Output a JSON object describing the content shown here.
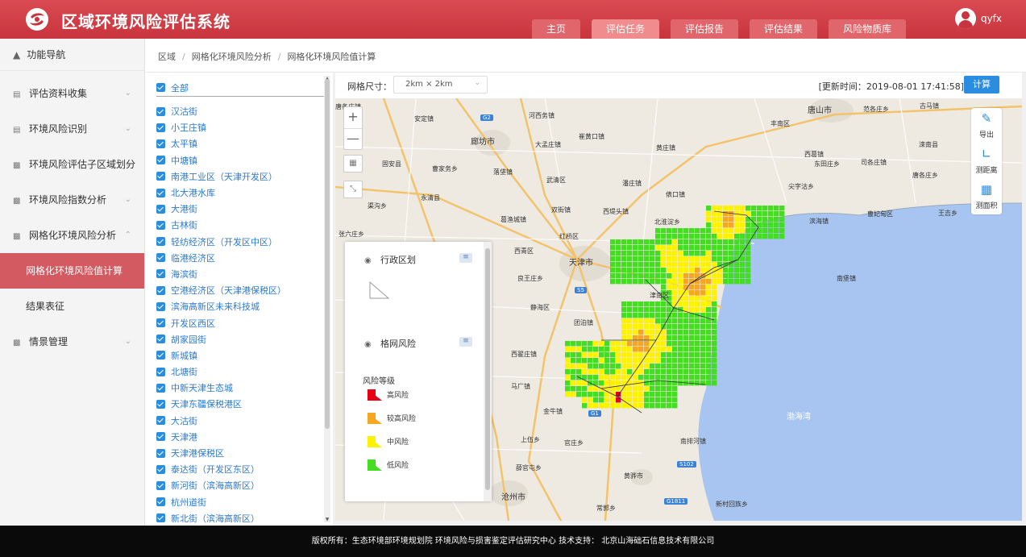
{
  "app": {
    "title": "区域环境风险评估系统"
  },
  "header": {
    "tabs": [
      {
        "label": "主页",
        "active": false
      },
      {
        "label": "评估任务",
        "active": true
      },
      {
        "label": "评估报告",
        "active": false
      },
      {
        "label": "评估结果",
        "active": false
      },
      {
        "label": "风险物质库",
        "active": false
      }
    ],
    "user": "qyfx"
  },
  "sidebar": {
    "heading": "功能导航",
    "items": [
      {
        "label": "评估资料收集"
      },
      {
        "label": "环境风险识别"
      },
      {
        "label": "环境风险评估子区域划分"
      },
      {
        "label": "环境风险指数分析"
      },
      {
        "label": "网格化环境风险分析"
      },
      {
        "label": "网格化环境风险值计算",
        "selected": true
      },
      {
        "label": "结果表征"
      },
      {
        "label": "情景管理"
      }
    ]
  },
  "breadcrumb": [
    "区域",
    "网格化环境风险分析",
    "网格化环境风险值计算"
  ],
  "tree": {
    "all_label": "全部",
    "items": [
      "汉沽街",
      "小王庄镇",
      "太平镇",
      "中塘镇",
      "南港工业区（天津开发区）",
      "北大港水库",
      "大港街",
      "古林街",
      "轻纺经济区（开发区中区）",
      "临港经济区",
      "海滨街",
      "空港经济区（天津港保税区）",
      "滨海高新区未来科技城",
      "开发区西区",
      "胡家园街",
      "新城镇",
      "北塘街",
      "中新天津生态城",
      "天津东疆保税港区",
      "大沽街",
      "天津港",
      "天津港保税区",
      "泰达街（开发区东区）",
      "新河街（滨海高新区）",
      "杭州道街",
      "新北街（滨海高新区）"
    ]
  },
  "toolbar": {
    "grid_label": "网格尺寸：",
    "grid_value": "2km × 2km",
    "update_text": "[更新时间：2019-08-01 17:41:58]",
    "calc_label": "计算"
  },
  "map": {
    "zoom_in": "+",
    "zoom_out": "—",
    "tools": [
      {
        "label": "导出",
        "icon": "export-icon"
      },
      {
        "label": "测距离",
        "icon": "ruler-icon"
      },
      {
        "label": "测面积",
        "icon": "area-icon"
      }
    ],
    "labels": {
      "l1": "唐各庄镇",
      "l2": "安定镇",
      "l3": "河西务镇",
      "l4": "唐山市",
      "l5": "范各庄乡",
      "l6": "古马镇",
      "l7": "丰南区",
      "l8": "廊坊市",
      "l9": "崔黄口镇",
      "l10": "大孟庄镇",
      "l11": "黄庄镇",
      "l12": "西葛镇",
      "l13": "滦南县",
      "l14": "固安县",
      "l15": "曹家务乡",
      "l16": "落垡镇",
      "l17": "武清区",
      "l18": "东田庄乡",
      "l19": "司各庄镇",
      "l20": "唐各庄乡",
      "l21": "永清县",
      "l22": "潘庄镇",
      "l23": "尖字沽乡",
      "l24": "俵口镇",
      "l25": "渠沟乡",
      "l26": "双街镇",
      "l27": "西堤头镇",
      "l28": "曹妃甸区",
      "l29": "王吉乡",
      "l30": "葛渔城镇",
      "l31": "北淮淀乡",
      "l32": "滨海镇",
      "l33": "张六庄乡",
      "l34": "红桥区",
      "l35": "西青区",
      "l36": "天津市",
      "l37": "良王庄乡",
      "l38": "津南区",
      "l39": "南堡镇",
      "l40": "静海区",
      "l41": "团泊镇",
      "l42": "西翟庄镇",
      "l43": "马厂镇",
      "l44": "金牛镇",
      "l45": "上伍乡",
      "l46": "官庄乡",
      "l47": "南排河镇",
      "l48": "薛官屯乡",
      "l49": "黄骅市",
      "l50": "沧州市",
      "l51": "常郭乡",
      "l52": "新村回族乡",
      "l53": "渤海湾"
    },
    "highways": [
      "G2",
      "S5",
      "G1",
      "S102",
      "G1811"
    ]
  },
  "layers": {
    "admin": {
      "title": "行政区划"
    },
    "grid": {
      "title": "格网风险"
    },
    "legend_title": "风险等级",
    "legend": [
      {
        "label": "高风险",
        "color": "#e60012"
      },
      {
        "label": "较高风险",
        "color": "#f5a623"
      },
      {
        "label": "中风险",
        "color": "#fff200"
      },
      {
        "label": "低风险",
        "color": "#44dd22"
      }
    ]
  },
  "footer": {
    "text": "版权所有：生态环境部环境规划院 环境风险与损害鉴定评估研究中心    技术支持：   北京山海础石信息技术有限公司"
  }
}
